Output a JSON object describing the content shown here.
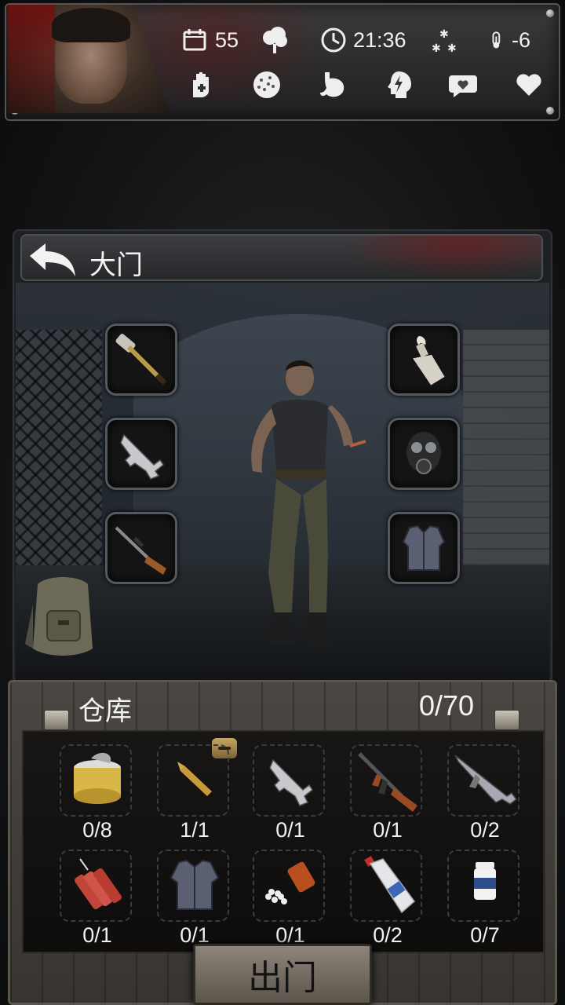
{
  "hud": {
    "days": "55",
    "time": "21:36",
    "temperature": "-6",
    "stat_icons": [
      "calendar-icon",
      "weather-icon",
      "clock-icon",
      "snow-icon",
      "thermometer-icon"
    ],
    "status_icons": [
      "bandage-hand-icon",
      "infection-icon",
      "stomach-icon",
      "energy-head-icon",
      "mood-icon",
      "health-heart-icon"
    ]
  },
  "location": {
    "title": "大门",
    "left_slots": [
      "sledgehammer-icon",
      "pistol-icon",
      "hunting-rifle-icon"
    ],
    "right_slots": [
      "molotov-icon",
      "gas-mask-icon",
      "body-armor-icon"
    ]
  },
  "warehouse": {
    "title": "仓库",
    "capacity": "0/70",
    "items": [
      {
        "icon": "canned-food-icon",
        "count": "0/8"
      },
      {
        "icon": "bullet-icon",
        "count": "1/1"
      },
      {
        "icon": "pistol-icon",
        "count": "0/1"
      },
      {
        "icon": "assault-rifle-icon",
        "count": "0/1"
      },
      {
        "icon": "submachine-gun-icon",
        "count": "0/2"
      },
      {
        "icon": "dynamite-icon",
        "count": "0/1"
      },
      {
        "icon": "body-armor-icon",
        "count": "0/1"
      },
      {
        "icon": "pills-bottle-icon",
        "count": "0/1"
      },
      {
        "icon": "alcohol-bottle-icon",
        "count": "0/2"
      },
      {
        "icon": "medicine-jar-icon",
        "count": "0/7"
      }
    ]
  },
  "actions": {
    "go_out": "出门"
  }
}
